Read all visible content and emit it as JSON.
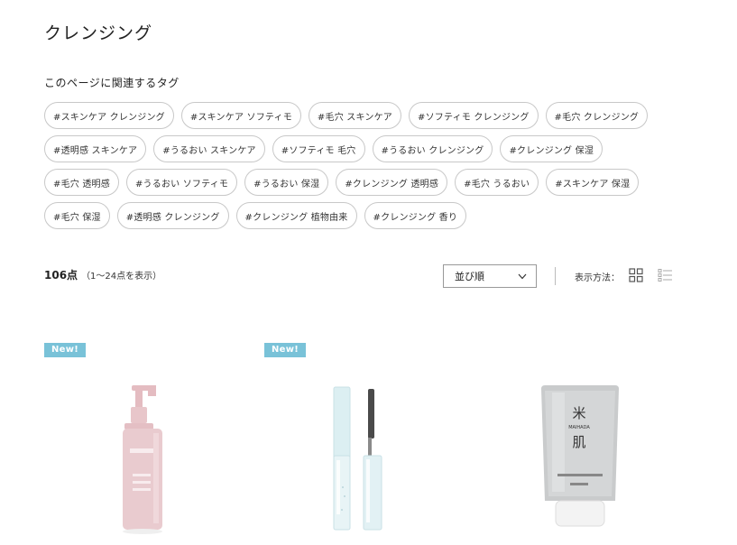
{
  "page": {
    "title": "クレンジング",
    "tags_heading": "このページに関連するタグ"
  },
  "tag_rows": [
    [
      "#スキンケア クレンジング",
      "#スキンケア ソフティモ",
      "#毛穴 スキンケア",
      "#ソフティモ クレンジング",
      "#毛穴 クレンジング"
    ],
    [
      "#透明感 スキンケア",
      "#うるおい スキンケア",
      "#ソフティモ 毛穴",
      "#うるおい クレンジング",
      "#クレンジング 保湿"
    ],
    [
      "#毛穴 透明感",
      "#うるおい ソフティモ",
      "#うるおい 保湿",
      "#クレンジング 透明感",
      "#毛穴 うるおい",
      "#スキンケア 保湿"
    ],
    [
      "#毛穴 保湿",
      "#透明感 クレンジング",
      "#クレンジング 植物由来",
      "#クレンジング 香り"
    ]
  ],
  "results": {
    "count": "106点",
    "range": "（1〜24点を表示）"
  },
  "toolbar": {
    "sort_selected": "並び順",
    "display_label": "表示方法："
  },
  "products": [
    {
      "badge": "New!",
      "image": "pink-pump-bottle",
      "color": "#e7c3c7"
    },
    {
      "badge": "New!",
      "image": "mascara-tube",
      "color": "#dbeef1"
    },
    {
      "badge": "",
      "image": "komehada-cleansing-tube",
      "color": "#c9cbcc",
      "label_top": "米",
      "label_brand": "MAIHADA",
      "label_bottom": "肌"
    }
  ],
  "colors": {
    "badge": "#79c2d8",
    "tag_border": "#c8c8c8"
  }
}
